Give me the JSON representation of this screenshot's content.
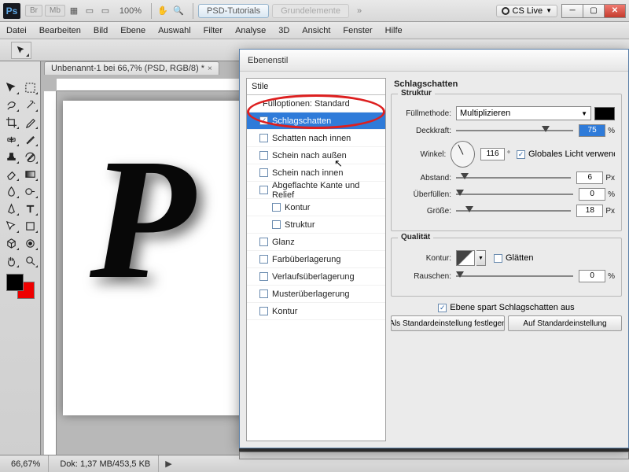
{
  "app": {
    "logo": "Ps",
    "btns": [
      "Br",
      "Mb"
    ],
    "zoom": "100%",
    "pills": {
      "a": "PSD-Tutorials",
      "b": "Grundelemente"
    },
    "cslive": "CS Live"
  },
  "menu": [
    "Datei",
    "Bearbeiten",
    "Bild",
    "Ebene",
    "Auswahl",
    "Filter",
    "Analyse",
    "3D",
    "Ansicht",
    "Fenster",
    "Hilfe"
  ],
  "doc_tab": "Unbenannt-1 bei 66,7% (PSD, RGB/8) *",
  "canvas_glyph": "P",
  "status": {
    "zoom": "66,67%",
    "dok": "Dok: 1,37 MB/453,5 KB"
  },
  "dialog": {
    "title": "Ebenenstil",
    "stile_head": "Stile",
    "fill_opts": "Fülloptionen: Standard",
    "items": [
      {
        "label": "Schlagschatten",
        "checked": true,
        "sel": true
      },
      {
        "label": "Schatten nach innen",
        "checked": false
      },
      {
        "label": "Schein nach außen",
        "checked": false
      },
      {
        "label": "Schein nach innen",
        "checked": false
      },
      {
        "label": "Abgeflachte Kante und Relief",
        "checked": false
      },
      {
        "label": "Kontur",
        "checked": false,
        "sub": true
      },
      {
        "label": "Struktur",
        "checked": false,
        "sub": true
      },
      {
        "label": "Glanz",
        "checked": false
      },
      {
        "label": "Farbüberlagerung",
        "checked": false
      },
      {
        "label": "Verlaufsüberlagerung",
        "checked": false
      },
      {
        "label": "Musterüberlagerung",
        "checked": false
      },
      {
        "label": "Kontur",
        "checked": false
      }
    ],
    "rt_title": "Schlagschatten",
    "struktur": "Struktur",
    "fullmethode_lbl": "Füllmethode:",
    "fullmethode_val": "Multiplizieren",
    "deckkraft_lbl": "Deckkraft:",
    "deckkraft_val": "75",
    "winkel_lbl": "Winkel:",
    "winkel_val": "116",
    "globales": "Globales Licht verwenden",
    "abstand_lbl": "Abstand:",
    "abstand_val": "6",
    "uberfullen_lbl": "Überfüllen:",
    "uberfullen_val": "0",
    "grosse_lbl": "Größe:",
    "grosse_val": "18",
    "qualitat": "Qualität",
    "kontur_lbl": "Kontur:",
    "glatten": "Glätten",
    "rauschen_lbl": "Rauschen:",
    "rauschen_val": "0",
    "knockout": "Ebene spart Schlagschatten aus",
    "btn1": "Als Standardeinstellung festlegen",
    "btn2": "Auf Standardeinstellung",
    "px": "Px",
    "deg": "°",
    "pct": "%"
  }
}
